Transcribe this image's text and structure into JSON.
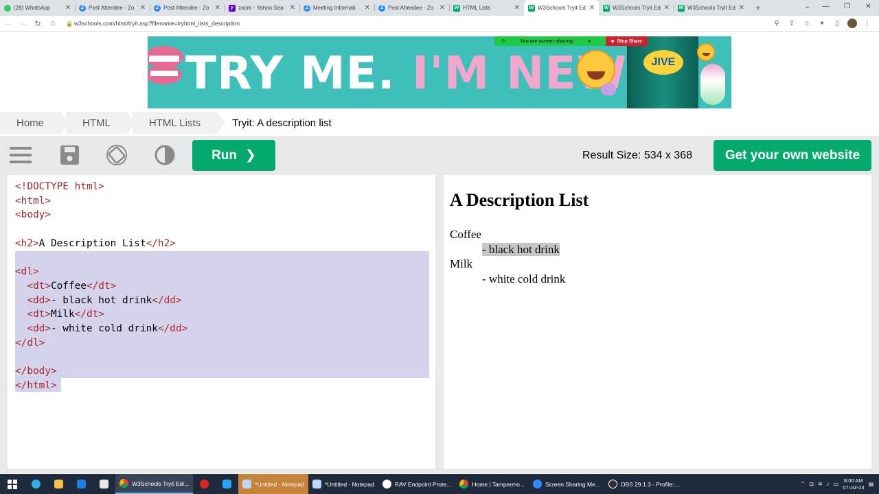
{
  "browser": {
    "tabs": [
      {
        "label": "(28) WhatsApp",
        "icon": "whatsapp-icon",
        "active": false
      },
      {
        "label": "Post Attendee - Zo",
        "icon": "zoom-icon",
        "active": false
      },
      {
        "label": "Post Attendee - Zo",
        "icon": "zoom-icon",
        "active": false
      },
      {
        "label": "zoom - Yahoo Sea",
        "icon": "yahoo-icon",
        "active": false
      },
      {
        "label": "Meeting Informati",
        "icon": "zoom-icon",
        "active": false
      },
      {
        "label": "Post Attendee - Zo",
        "icon": "zoom-icon",
        "active": false
      },
      {
        "label": "HTML Lists",
        "icon": "w3schools-icon",
        "active": false
      },
      {
        "label": "W3Schools Tryit Ed",
        "icon": "w3schools-icon",
        "active": true
      },
      {
        "label": "W3Schools Tryit Ed",
        "icon": "w3schools-icon",
        "active": false
      },
      {
        "label": "W3Schools Tryit Ed",
        "icon": "w3schools-icon",
        "active": false
      }
    ],
    "new_tab": "+",
    "url": "w3schools.com/html/tryit.asp?filename=tryhtml_lists_description"
  },
  "banner": {
    "text_white_1": "TRY ME.",
    "text_pink": "I'M NEW",
    "text_white_2": "!",
    "brand": "JIVE",
    "share_status": "You are screen sharing",
    "stop_share": "Stop Share"
  },
  "breadcrumbs": [
    "Home",
    "HTML",
    "HTML Lists"
  ],
  "breadcrumb_current": "Tryit: A description list",
  "tryit": {
    "run_label": "Run",
    "result_size": "Result Size: 534 x 368",
    "get_website": "Get your own website"
  },
  "code_lines": [
    "<!DOCTYPE html>",
    "<html>",
    "<body>",
    "",
    "<h2>A Description List</h2>",
    "",
    "<dl>",
    "  <dt>Coffee</dt>",
    "  <dd>- black hot drink</dd>",
    "  <dt>Milk</dt>",
    "  <dd>- white cold drink</dd>",
    "</dl>",
    "",
    "</body>",
    "</html>"
  ],
  "result": {
    "heading": "A Description List",
    "items": [
      {
        "term": "Coffee",
        "desc": "- black hot drink"
      },
      {
        "term": "Milk",
        "desc": "- white cold drink"
      }
    ]
  },
  "taskbar": {
    "apps": [
      {
        "label": "W3Schools Tryit Edi...",
        "active": true
      },
      {
        "label": "*Untitled - Notepad",
        "active": false,
        "highlight": true
      },
      {
        "label": "*Untitled - Notepad",
        "active": false
      },
      {
        "label": "RAV Endpoint Prote...",
        "active": false
      },
      {
        "label": "Home | Tampermo...",
        "active": false
      },
      {
        "label": "Screen Sharing Me...",
        "active": false
      },
      {
        "label": "OBS 29.1.3 - Profile:...",
        "active": false
      }
    ],
    "time": "8:00 AM",
    "date": "07-Jul-23"
  },
  "colors": {
    "w3_green": "#04aa6d",
    "code_tag": "#a52a2a",
    "selection": "#d5d3ec",
    "banner_bg": "#3fbfba",
    "banner_pink": "#f2a7cc"
  }
}
